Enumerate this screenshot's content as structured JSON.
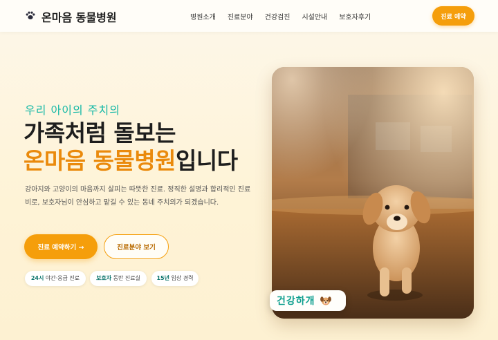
{
  "brand": {
    "name": "온마음 동물병원",
    "icon": "paw-icon"
  },
  "nav": {
    "items": [
      "병원소개",
      "진료분야",
      "건강검진",
      "시설안내",
      "보호자후기"
    ],
    "cta_label": "진료 예약"
  },
  "hero": {
    "eyebrow": "우리 아이의 주치의",
    "title_line1": "가족처럼 돌보는",
    "title_accent": "온마음 동물병원",
    "title_suffix": "입니다",
    "description": "강아지와 고양이의 마음까지 살피는 따뜻한 진료. 정직한 설명과 합리적인 진료비로, 보호자님이 안심하고 맡길 수 있는 동네 주치의가 되겠습니다.",
    "primary_button": "진료 예약하기 →",
    "secondary_button": "진료분야 보기",
    "badges": [
      {
        "strong": "24시",
        "text": " 야간·응급 진료"
      },
      {
        "strong": "보호자",
        "text": " 동반 진료실"
      },
      {
        "strong": "15년",
        "text": " 임상 경력"
      }
    ]
  },
  "photo": {
    "chip_label": "건강하개",
    "chip_icon": "dog-face-icon"
  },
  "colors": {
    "accent": "#f59e0b",
    "accent_text": "#ea8a0c",
    "teal": "#14b8a6"
  }
}
